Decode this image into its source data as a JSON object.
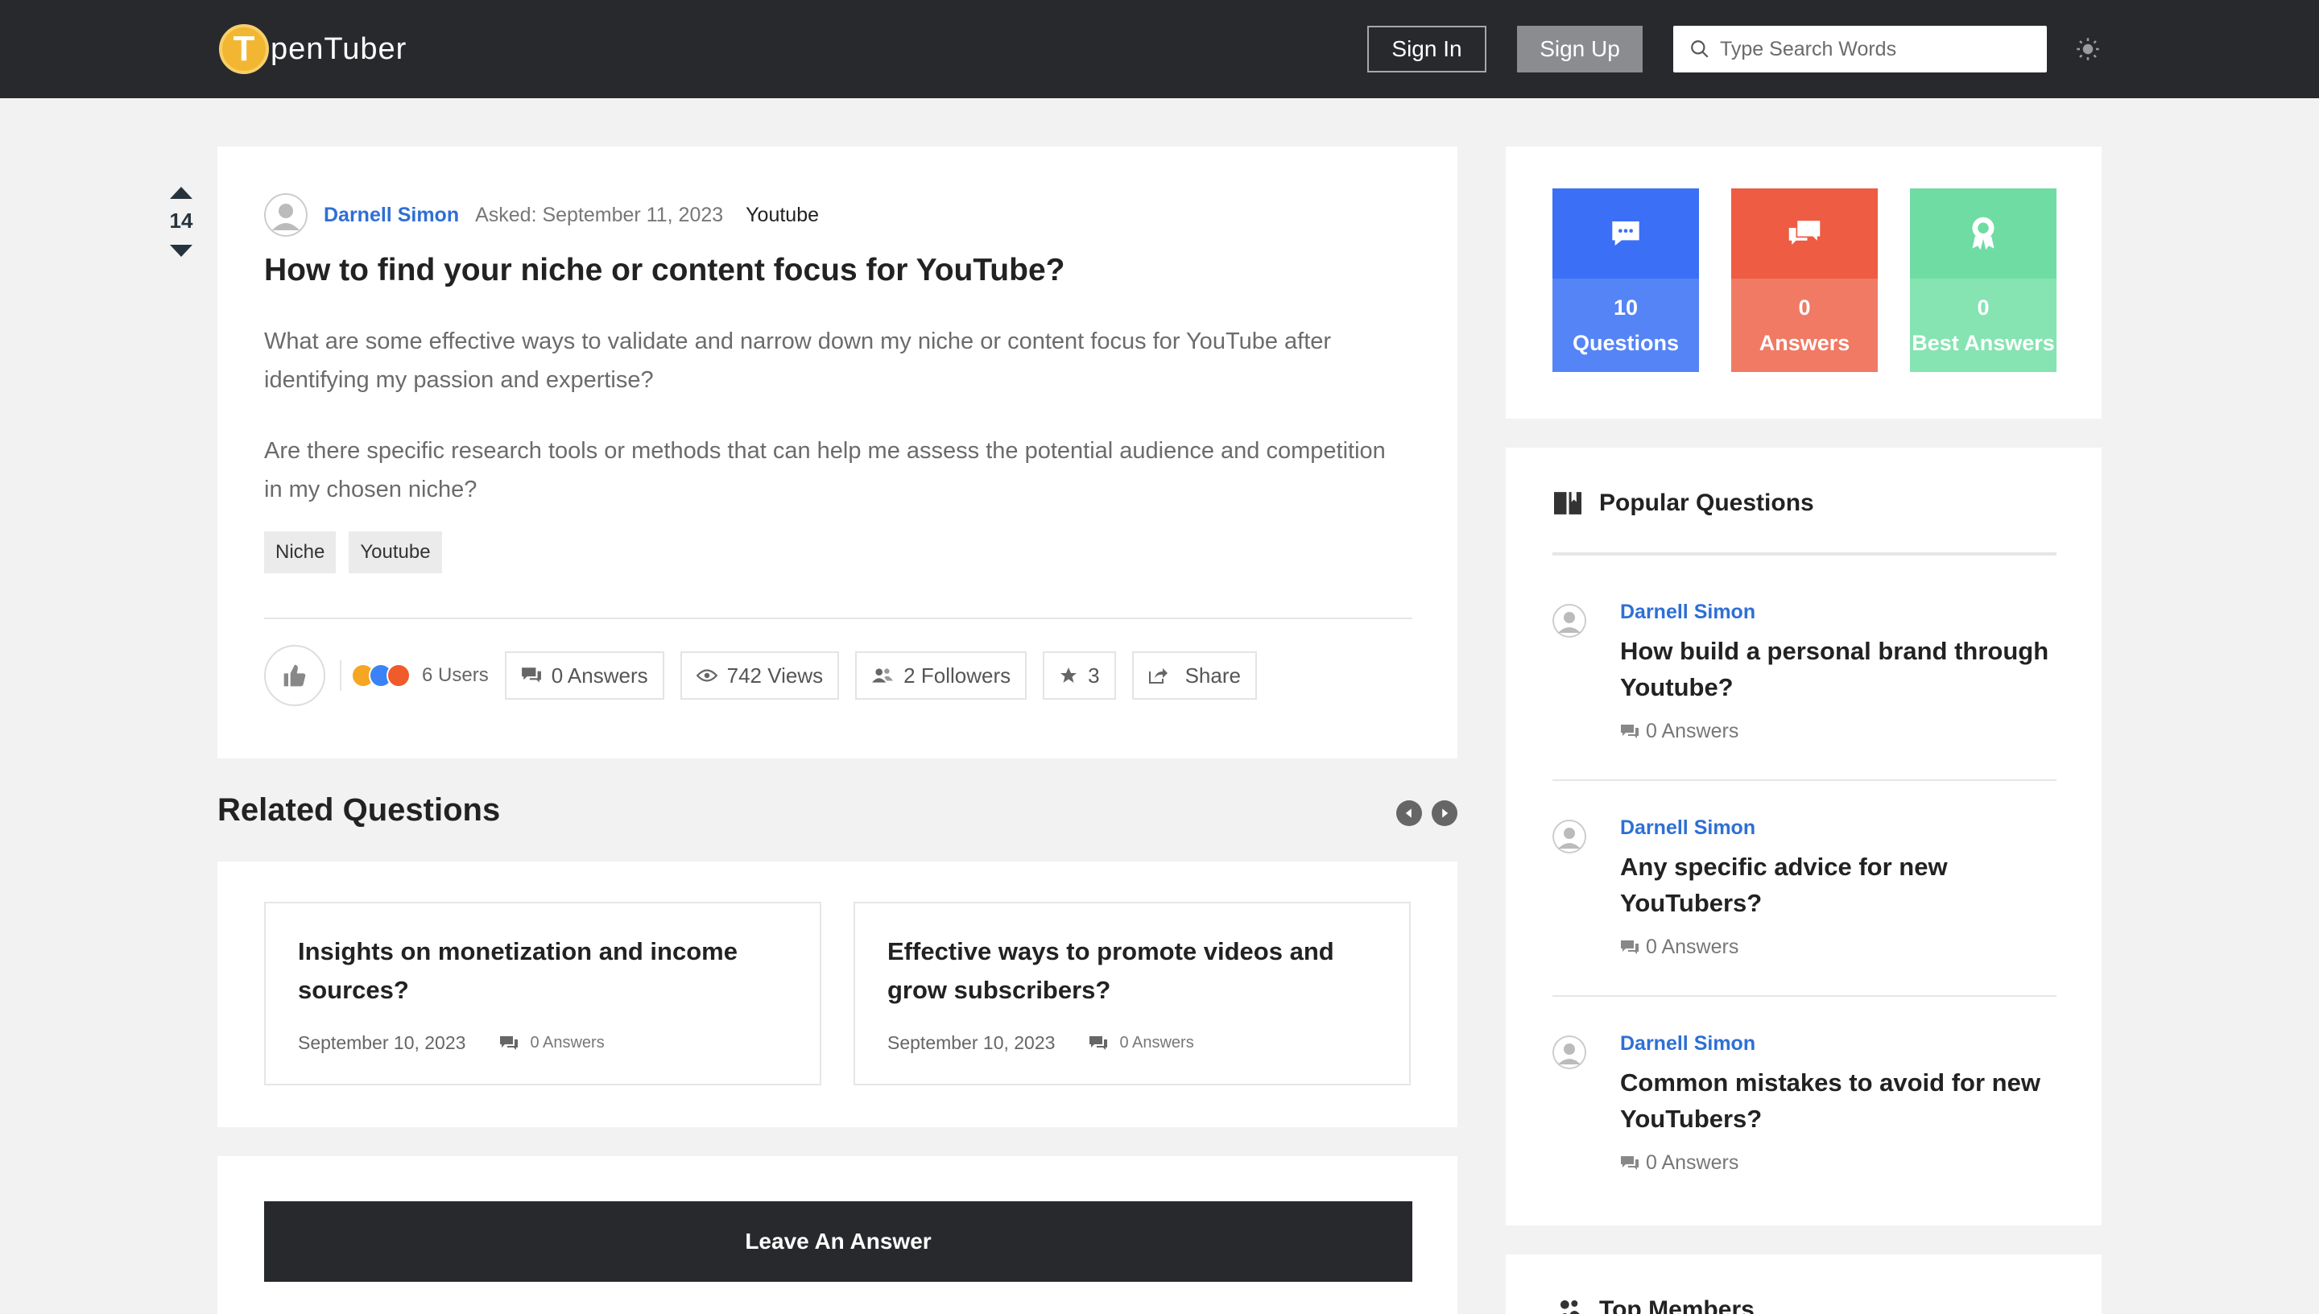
{
  "header": {
    "logo_letter": "T",
    "logo_text": "penTuber",
    "signin_label": "Sign In",
    "signup_label": "Sign Up",
    "search_placeholder": "Type Search Words",
    "theme_icon": "sun-icon"
  },
  "question": {
    "votes": "14",
    "author": "Darnell Simon",
    "asked": "Asked: September 11, 2023",
    "category": "Youtube",
    "title": "How to find your niche or content focus for YouTube?",
    "body": [
      "What are some effective ways to validate and narrow down my niche or content focus for YouTube after identifying my passion and expertise?",
      "Are there specific research tools or methods that can help me assess the potential audience and competition in my chosen niche?"
    ],
    "tags": [
      "Niche",
      "Youtube"
    ],
    "reaction_users": "6 Users",
    "answers": "0 Answers",
    "views": "742",
    "views_label": "Views",
    "followers": "2",
    "followers_label": "Followers",
    "favorites": "3",
    "share_label": "Share"
  },
  "related": {
    "title": "Related Questions",
    "items": [
      {
        "title": "Insights on monetization and income sources?",
        "date": "September 10, 2023",
        "answers": "0 Answers"
      },
      {
        "title": "Effective ways to promote videos and grow subscribers?",
        "date": "September 10, 2023",
        "answers": "0 Answers"
      }
    ]
  },
  "answer": {
    "button_label": "Leave An Answer"
  },
  "stats": [
    {
      "value": "10",
      "label": "Questions",
      "color_top": "#3b6ff5",
      "color_bottom": "#5584f6",
      "icon": "chat-bubble-icon"
    },
    {
      "value": "0",
      "label": "Answers",
      "color_top": "#ed5c43",
      "color_bottom": "#f07a64",
      "icon": "comments-icon"
    },
    {
      "value": "0",
      "label": "Best Answers",
      "color_top": "#6fdca3",
      "color_bottom": "#86e3b2",
      "icon": "award-icon"
    }
  ],
  "popular": {
    "title": "Popular Questions",
    "items": [
      {
        "author": "Darnell Simon",
        "title": "How build a personal brand through Youtube?",
        "answers": "0 Answers"
      },
      {
        "author": "Darnell Simon",
        "title": "Any specific advice for new YouTubers?",
        "answers": "0 Answers"
      },
      {
        "author": "Darnell Simon",
        "title": "Common mistakes to avoid for new YouTubers?",
        "answers": "0 Answers"
      }
    ]
  },
  "members": {
    "title": "Top Members"
  }
}
